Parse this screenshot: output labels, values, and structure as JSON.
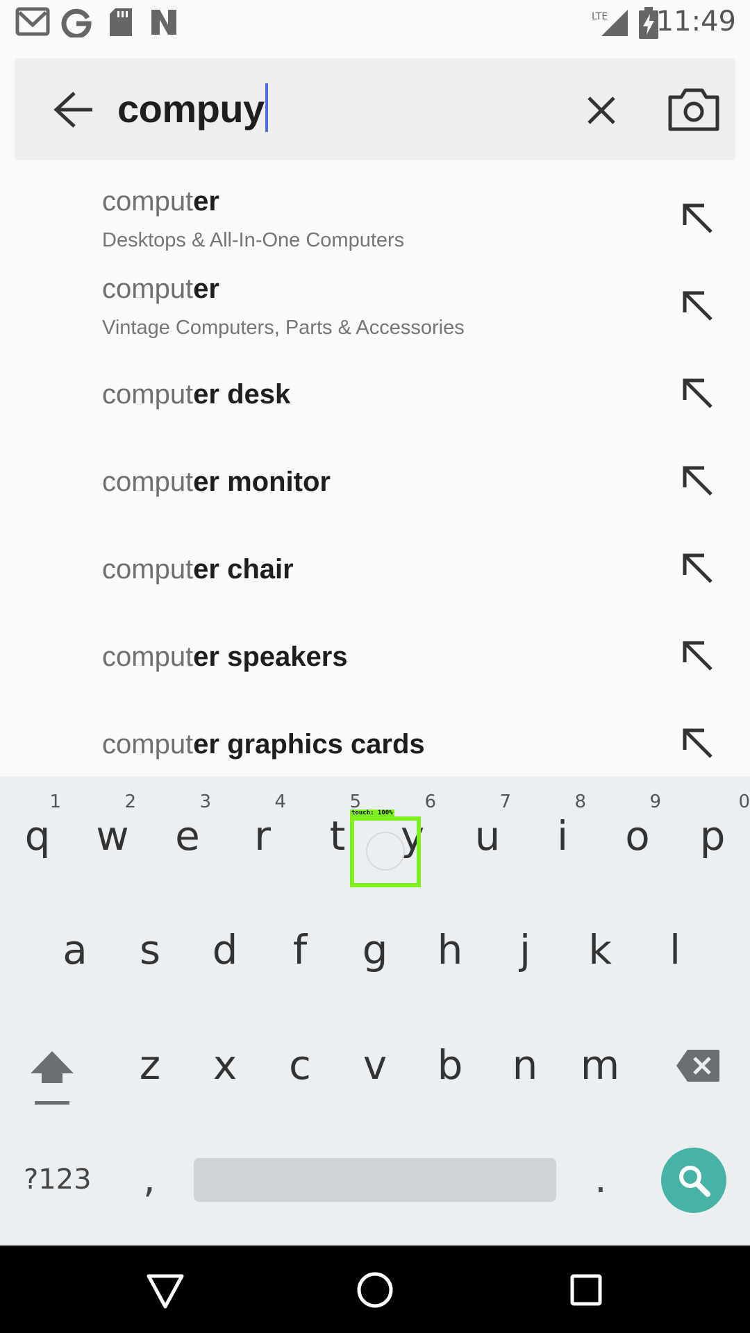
{
  "status_bar": {
    "time": "11:49",
    "network": "LTE",
    "icons": [
      "gmail-icon",
      "google-icon",
      "sd-card-icon",
      "n-icon",
      "signal-icon",
      "battery-charging-icon"
    ]
  },
  "search": {
    "query": "compuy",
    "icons": [
      "back-arrow-icon",
      "close-icon",
      "camera-icon"
    ]
  },
  "suggestions": [
    {
      "prefix": "comput",
      "suffix": "er",
      "category": "Desktops & All-In-One Computers"
    },
    {
      "prefix": "comput",
      "suffix": "er",
      "category": "Vintage Computers, Parts & Accessories"
    },
    {
      "prefix": "comput",
      "suffix": "er desk",
      "category": ""
    },
    {
      "prefix": "comput",
      "suffix": "er monitor",
      "category": ""
    },
    {
      "prefix": "comput",
      "suffix": "er chair",
      "category": ""
    },
    {
      "prefix": "comput",
      "suffix": "er speakers",
      "category": ""
    },
    {
      "prefix": "comput",
      "suffix": "er graphics cards",
      "category": ""
    }
  ],
  "keyboard": {
    "row1": [
      "q",
      "w",
      "e",
      "r",
      "t",
      "y",
      "u",
      "i",
      "o",
      "p"
    ],
    "row1_hints": [
      "1",
      "2",
      "3",
      "4",
      "5",
      "6",
      "7",
      "8",
      "9",
      "0"
    ],
    "row2": [
      "a",
      "s",
      "d",
      "f",
      "g",
      "h",
      "j",
      "k",
      "l"
    ],
    "row3": [
      "z",
      "x",
      "c",
      "v",
      "b",
      "n",
      "m"
    ],
    "symbols_label": "?123",
    "comma_label": ",",
    "period_label": ".",
    "touch_label": "touch: 100%"
  },
  "colors": {
    "accent_caret": "#4a6cf0",
    "search_key": "#47b3a6",
    "touch_box": "#7ef01c"
  }
}
